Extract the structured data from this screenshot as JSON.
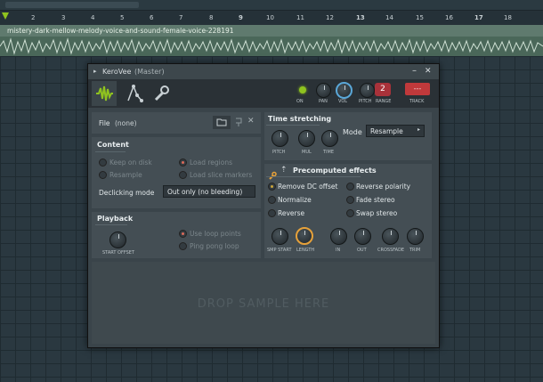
{
  "timeline": {
    "ruler_ticks": [
      "2",
      "3",
      "4",
      "5",
      "6",
      "7",
      "8",
      "9",
      "10",
      "11",
      "12",
      "13",
      "14",
      "15",
      "16",
      "17",
      "18"
    ],
    "clip_name": "mistery-dark-mellow-melody-voice-and-sound-female-voice-228191"
  },
  "plugin": {
    "title": "KeroVee",
    "title_suffix": "(Master)",
    "minimize": "–",
    "close": "✕",
    "toolbar": {
      "on_label": "ON",
      "pan_label": "PAN",
      "vol_label": "VOL",
      "pitch_label": "PITCH",
      "range_label": "RANGE",
      "range_value": "2",
      "track_label": "TRACK",
      "track_value": "---"
    },
    "file": {
      "label": "File",
      "value": "(none)"
    },
    "content": {
      "header": "Content",
      "keep_on_disk": "Keep on disk",
      "resample": "Resample",
      "load_regions": "Load regions",
      "load_slice_markers": "Load slice markers",
      "declicking_label": "Declicking mode",
      "declicking_value": "Out only (no bleeding)"
    },
    "playback": {
      "header": "Playback",
      "start_offset": "START OFFSET",
      "use_loop_points": "Use loop points",
      "ping_pong_loop": "Ping pong loop"
    },
    "time_stretching": {
      "header": "Time stretching",
      "pitch": "PITCH",
      "mul": "MUL",
      "time": "TIME",
      "mode_label": "Mode",
      "mode_value": "Resample"
    },
    "precomputed": {
      "header": "Precomputed effects",
      "remove_dc": "Remove DC offset",
      "normalize": "Normalize",
      "reverse": "Reverse",
      "reverse_polarity": "Reverse polarity",
      "fade_stereo": "Fade stereo",
      "swap_stereo": "Swap stereo",
      "knobs": [
        "SMP START",
        "LENGTH",
        "IN",
        "OUT",
        "CROSSFADE",
        "TRIM"
      ]
    },
    "drop_text": "DROP SAMPLE HERE",
    "colors": {
      "accent_green": "#8fc31f",
      "accent_orange": "#e6a13a",
      "accent_red": "#c0393b",
      "vol_blue": "#5aa7d8"
    }
  }
}
